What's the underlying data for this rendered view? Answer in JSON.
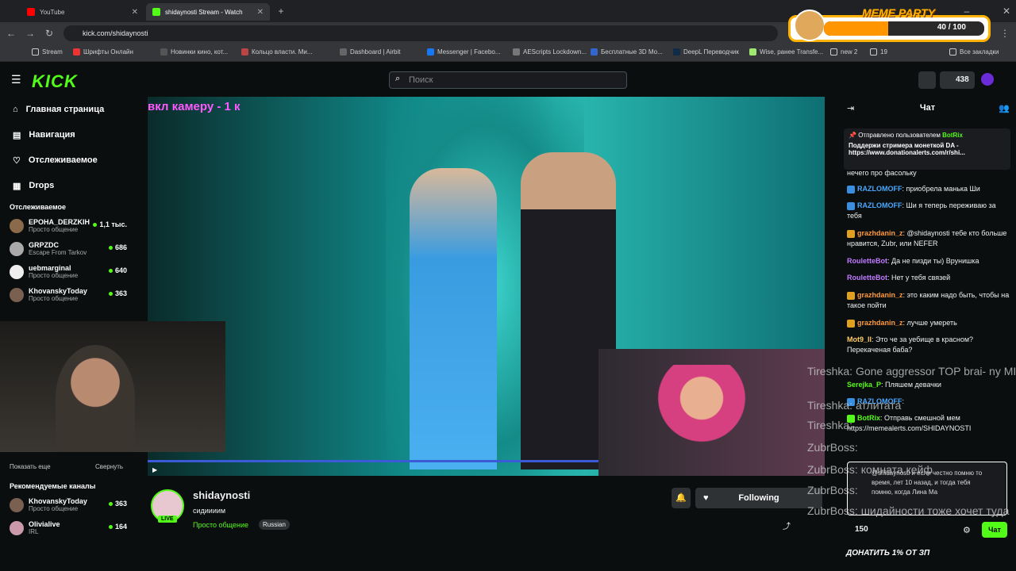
{
  "browser": {
    "tabs": [
      {
        "title": "YouTube"
      },
      {
        "title": "shidaynosti Stream - Watch"
      }
    ],
    "url": "kick.com/shidaynosti",
    "bookmarks": [
      "Stream",
      "Шрифты Онлайн",
      "Новинки кино, кот...",
      "Кольцо власти. Ми...",
      "Dashboard | Airbit",
      "Messenger | Facebo...",
      "AEScripts Lockdown...",
      "Бесплатные 3D Мо...",
      "DeepL Переводчик",
      "Wise, ранее Transfe...",
      "new 2",
      "19",
      "Все закладки"
    ]
  },
  "meme_party": {
    "label": "MEME PARTY",
    "count": "40 / 100",
    "progress": 0.4
  },
  "header": {
    "logo": "KICK",
    "search_placeholder": "Поиск",
    "coins": "438"
  },
  "sidebar": {
    "nav": [
      {
        "label": "Главная страница",
        "icon": "home-icon"
      },
      {
        "label": "Навигация",
        "icon": "browse-icon"
      },
      {
        "label": "Отслеживаемое",
        "icon": "heart-icon"
      },
      {
        "label": "Drops",
        "icon": "drops-icon"
      }
    ],
    "following_title": "Отслеживаемое",
    "following": [
      {
        "name": "EPOHA_DERZKIH",
        "category": "Просто общение",
        "viewers": "1,1 тыс."
      },
      {
        "name": "GRPZDC",
        "category": "Escape From Tarkov",
        "viewers": "686"
      },
      {
        "name": "uebmarginal",
        "category": "Просто общение",
        "viewers": "640"
      },
      {
        "name": "KhovanskyToday",
        "category": "Просто общение",
        "viewers": "363"
      }
    ],
    "show_more": "Показать еще",
    "collapse": "Свернуть",
    "recommended_title": "Рекомендуемые каналы",
    "recommended": [
      {
        "name": "KhovanskyToday",
        "category": "Просто общение",
        "viewers": "363"
      },
      {
        "name": "Olivialive",
        "category": "IRL",
        "viewers": "164"
      }
    ]
  },
  "video": {
    "overlay_text": "вкл камеру - 1 к"
  },
  "stream": {
    "name": "shidaynosti",
    "title": "сидиииим",
    "category": "Просто общение",
    "language": "Russian",
    "live": "LIVE",
    "follow_label": "Following"
  },
  "chat": {
    "title": "Чат",
    "pinned_by": "Отправлено пользователем",
    "pinned_user": "BotRix",
    "pinned_text": "Поддержи стримера монеткой DA - https://www.donationalerts.com/r/shi...",
    "messages": [
      {
        "user": "",
        "text": "нечего про фасольку"
      },
      {
        "user": "RAZLOMOFF",
        "text": ": приобрела манька Ши"
      },
      {
        "user": "RAZLOMOFF",
        "text": ": Ши я теперь переживаю за тебя"
      },
      {
        "user": "grazhdanin_z",
        "text": ": @shidaynosti тебе кто больше нравится, Zubr, или NEFER"
      },
      {
        "user": "RouletteBot",
        "text": ": Да не пизди ты) Врунишка"
      },
      {
        "user": "RouletteBot",
        "text": ": Нет у тебя связей"
      },
      {
        "user": "grazhdanin_z",
        "text": ": это каким надо быть, чтобы на такое пойти"
      },
      {
        "user": "grazhdanin_z",
        "text": ": лучше умереть"
      },
      {
        "user": "Mot9_ll",
        "text": ": Это че за уебище в красном? Перекаченая баба?"
      },
      {
        "user": "Serejka_P",
        "text": ": Пляшем девачки"
      },
      {
        "user": "RAZLOMOFF",
        "text": ":"
      },
      {
        "user": "BotRix",
        "text": ": Отправь смешной мем https://memealerts.com/SHIDAYNOSTI"
      }
    ],
    "input_text": "@shidaynosti и если честно помню то время, лет 10 назад, и тогда тебя помню, когда Лина Ма",
    "points": "150",
    "send_label": "Чат"
  },
  "tts_overlay": [
    "Tireshka: Gone aggressor TOP brai- ny MILFS",
    "Tireshka: атлитата",
    "Tireshka:",
    "ZubrBoss:",
    "ZubrBoss: комната кейф",
    "ZubrBoss:",
    "ZubrBoss: шидайности тоже хочет туда"
  ],
  "donate_banner": "ДОНАТИТЬ 1% ОТ ЗП",
  "colors": {
    "accent": "#53fc18",
    "bg": "#0b0e0f",
    "overlay_text": "#ff59ff"
  }
}
